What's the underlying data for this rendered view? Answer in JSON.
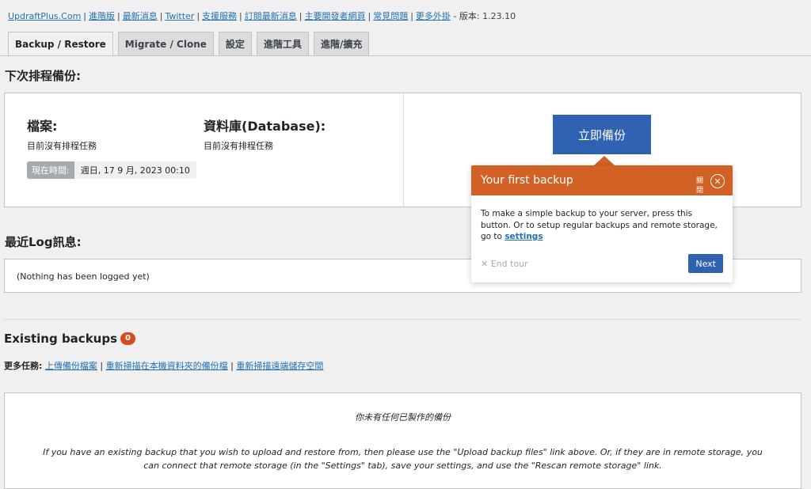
{
  "top_links": {
    "items": [
      "UpdraftPlus.Com",
      "進階版",
      "最新消息",
      "Twitter",
      "支援服務",
      "訂閱最新消息",
      "主要開發者網頁",
      "常見問題",
      "更多外掛"
    ],
    "version_text": "- 版本: 1.23.10"
  },
  "tabs": [
    "Backup / Restore",
    "Migrate / Clone",
    "設定",
    "進階工具",
    "進階/擴充"
  ],
  "schedule": {
    "heading": "下次排程備份:",
    "files_title": "檔案:",
    "files_desc": "目前沒有排程任務",
    "db_title": "資料庫(Database):",
    "db_desc": "目前沒有排程任務",
    "time_label": "現在時間:",
    "time_value": "週日, 17 9 月, 2023 00:10",
    "backup_now_label": "立即備份"
  },
  "log": {
    "heading": "最近Log訊息:",
    "message": "(Nothing has been logged yet)"
  },
  "existing": {
    "heading": "Existing backups",
    "count": "0",
    "more_tasks_label": "更多任務:",
    "links": [
      "上傳備份檔案",
      "重新掃描在本機資料夾的備份檔",
      "重新掃描遠端儲存空間"
    ],
    "none_text": "你未有任何已製作的備份",
    "hint_text": "If you have an existing backup that you wish to upload and restore from, then please use the \"Upload backup files\" link above. Or, if they are in remote storage, you can connect that remote storage (in the \"Settings\" tab), save your settings, and use the \"Rescan remote storage\" link."
  },
  "tour": {
    "title": "Your first backup",
    "close_label": "關閉",
    "body_text": "To make a simple backup to your server, press this button. Or to setup regular backups and remote storage, go to",
    "settings_link": "settings",
    "end_tour": "End tour",
    "next_label": "Next"
  },
  "colors": {
    "accent": "#2f62b0",
    "tour_header": "#d26125",
    "badge": "#d54e21"
  }
}
